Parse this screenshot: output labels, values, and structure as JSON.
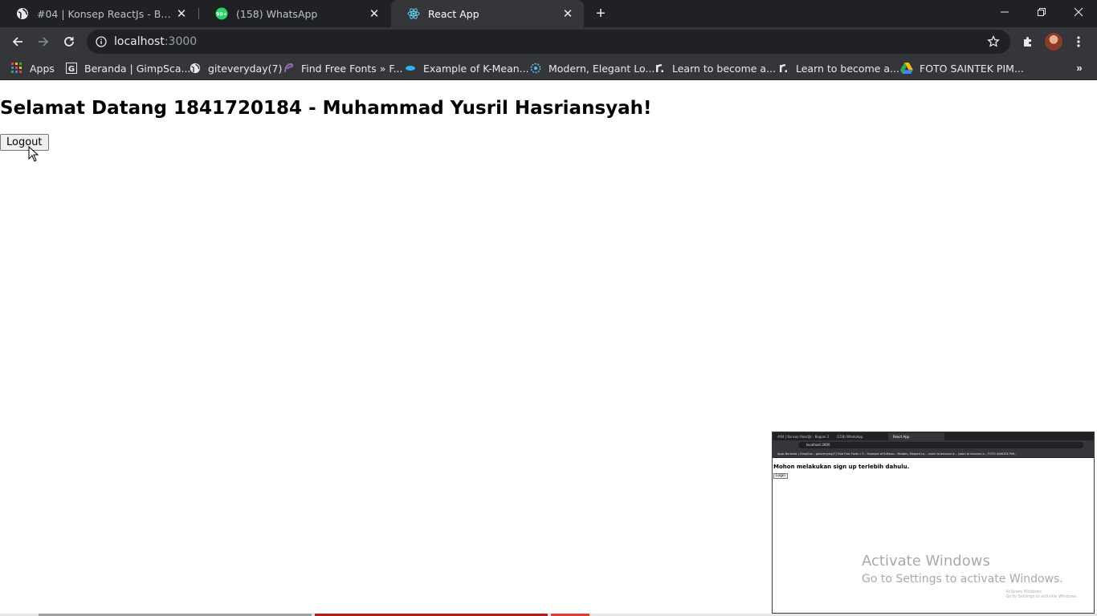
{
  "browser": {
    "tabs": [
      {
        "title": "#04 | Konsep ReactJs - Bagian 2",
        "favicon": "globe-icon",
        "active": false
      },
      {
        "title": "(158) WhatsApp",
        "favicon": "whatsapp-icon",
        "badge": "99+",
        "active": false
      },
      {
        "title": "React App",
        "favicon": "react-icon",
        "active": true
      }
    ],
    "address": {
      "host": "localhost",
      "port": ":3000"
    },
    "bookmarks": [
      {
        "label": "Apps",
        "icon": "apps-grid-icon"
      },
      {
        "label": "Beranda | GimpSca...",
        "icon": "gimpscape-icon"
      },
      {
        "label": "giteveryday(7)",
        "icon": "globe-icon"
      },
      {
        "label": "Find Free Fonts » F...",
        "icon": "fonts-icon"
      },
      {
        "label": "Example of K-Mean...",
        "icon": "kmeans-icon"
      },
      {
        "label": "Modern, Elegant Lo...",
        "icon": "logo-icon"
      },
      {
        "label": "Learn to become a...",
        "icon": "learn-icon"
      },
      {
        "label": "Learn to become a...",
        "icon": "learn-icon"
      },
      {
        "label": "FOTO SAINTEK PIM...",
        "icon": "google-drive-icon"
      }
    ]
  },
  "page": {
    "heading": "Selamat Datang 1841720184 - Muhammad Yusril Hasriansyah!",
    "logout_label": "Logout"
  },
  "thumbnail": {
    "tabs": [
      "#04 | Konsep ReactJs - Bagian 2",
      "(158) WhatsApp",
      "React App"
    ],
    "url": "localhost:3000",
    "bookmarks_line": "Apps   Beranda | GimpSca...   giteveryday(7)   Find Free Fonts » F...   Example of K-Mean...   Modern, Elegant Lo...   Learn to become a...   Learn to become a...   FOTO SAINTEK PIM...",
    "heading": "Mohon melakukan sign up terlebih dahulu.",
    "button_label": "Login",
    "watermark_small_1": "Activate Windows",
    "watermark_small_2": "Go to Settings to activate Windows."
  },
  "watermark": {
    "line1": "Activate Windows",
    "line2": "Go to Settings to activate Windows."
  }
}
